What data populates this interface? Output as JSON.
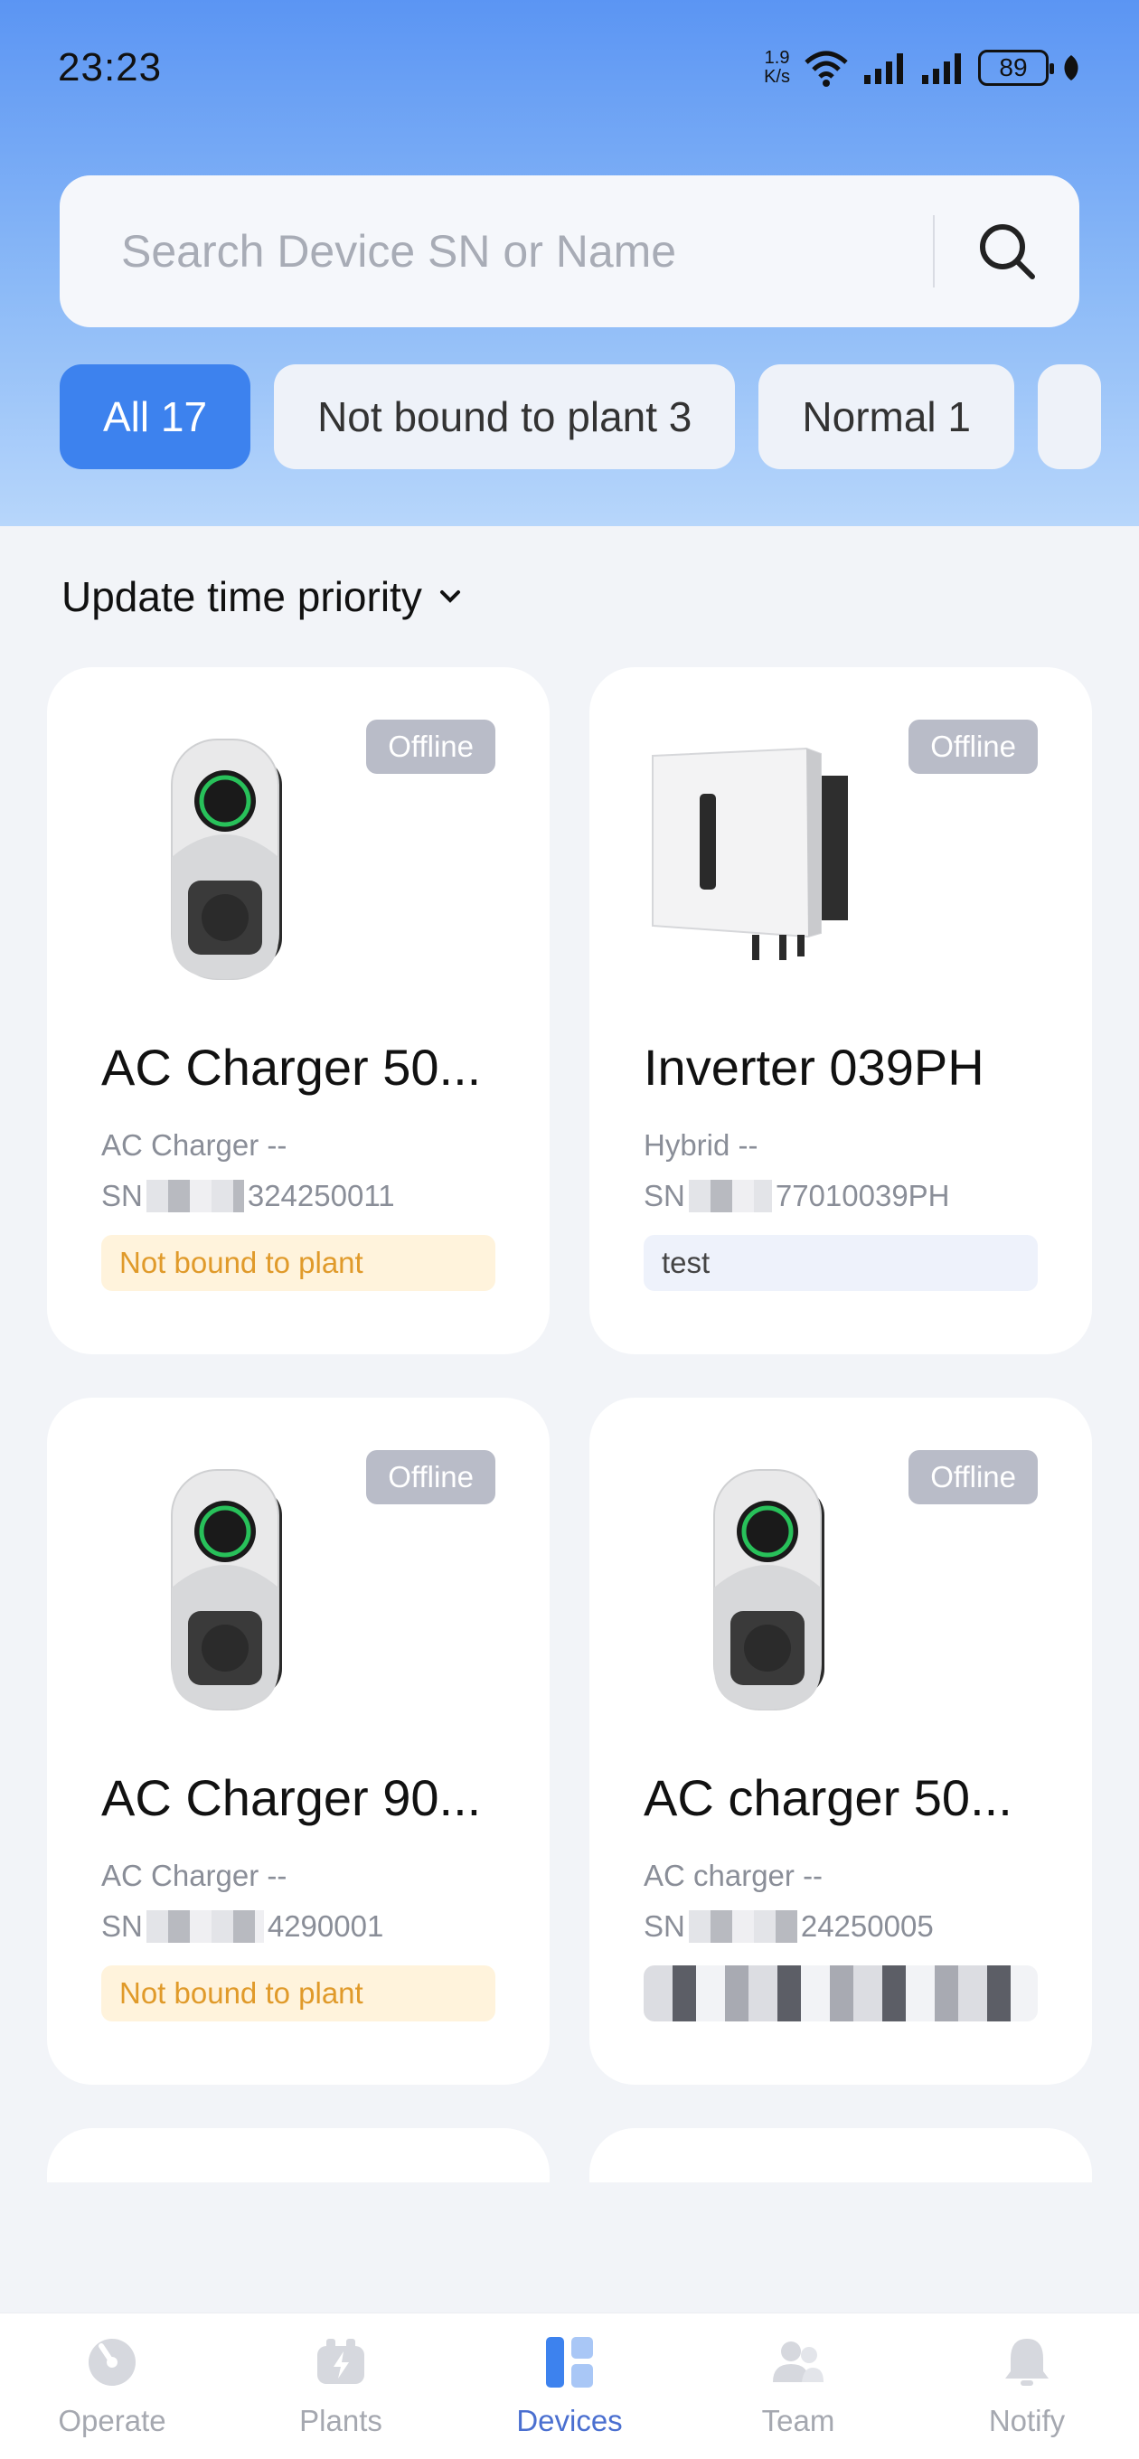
{
  "status_bar": {
    "time": "23:23",
    "net_speed": "1.9",
    "net_speed_unit": "K/s",
    "battery": "89"
  },
  "search": {
    "placeholder": "Search Device SN or Name"
  },
  "filters": [
    {
      "label": "All 17",
      "active": true
    },
    {
      "label": "Not bound to plant 3",
      "active": false
    },
    {
      "label": "Normal 1",
      "active": false
    }
  ],
  "sort": {
    "label": "Update time priority"
  },
  "devices": [
    {
      "name": "AC Charger 50...",
      "status": "Offline",
      "type": "AC Charger --",
      "sn_prefix": "SN",
      "sn_suffix": "324250011",
      "tag": "Not bound to plant",
      "tag_style": "warn",
      "image": "ac-charger"
    },
    {
      "name": "Inverter 039PH",
      "status": "Offline",
      "type": "Hybrid --",
      "sn_prefix": "SN",
      "sn_suffix": "77010039PH",
      "tag": "test",
      "tag_style": "plant",
      "image": "inverter"
    },
    {
      "name": "AC Charger 90...",
      "status": "Offline",
      "type": "AC Charger --",
      "sn_prefix": "SN",
      "sn_suffix": "4290001",
      "tag": "Not bound to plant",
      "tag_style": "warn",
      "image": "ac-charger"
    },
    {
      "name": "AC charger 50...",
      "status": "Offline",
      "type": "AC charger --",
      "sn_prefix": "SN",
      "sn_suffix": "24250005",
      "tag": "",
      "tag_style": "masked",
      "image": "ac-charger"
    }
  ],
  "tabbar": [
    {
      "label": "Operate",
      "icon": "operate-icon",
      "active": false
    },
    {
      "label": "Plants",
      "icon": "plants-icon",
      "active": false
    },
    {
      "label": "Devices",
      "icon": "devices-icon",
      "active": true
    },
    {
      "label": "Team",
      "icon": "team-icon",
      "active": false
    },
    {
      "label": "Notify",
      "icon": "bell-icon",
      "active": false
    }
  ],
  "colors": {
    "accent": "#3d82ee",
    "offline_badge": "#b9bcc8",
    "warn_tag_bg": "#fff3dc",
    "warn_tag_text": "#e09a2a"
  }
}
